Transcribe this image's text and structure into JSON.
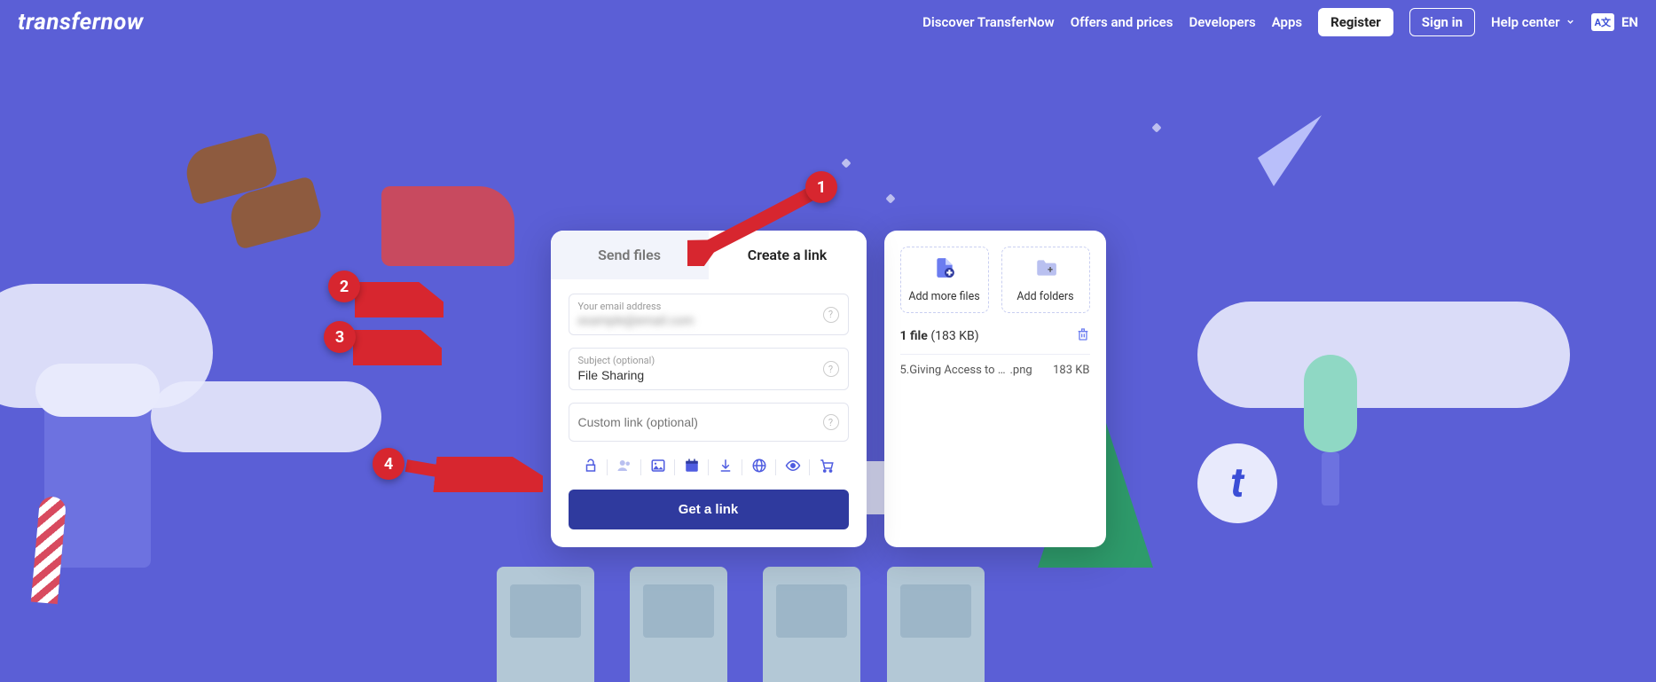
{
  "logo": "transfernow",
  "nav": {
    "discover": "Discover TransferNow",
    "offers": "Offers and prices",
    "developers": "Developers",
    "apps": "Apps",
    "register": "Register",
    "signin": "Sign in",
    "help": "Help center",
    "lang_badge": "A文",
    "lang_code": "EN"
  },
  "tabs": {
    "send": "Send files",
    "link": "Create a link"
  },
  "form": {
    "email_label": "Your email address",
    "email_value": "example@email.com",
    "subject_label": "Subject (optional)",
    "subject_value": "File Sharing",
    "customlink_placeholder": "Custom link (optional)",
    "cta": "Get a link"
  },
  "files": {
    "add_files": "Add more files",
    "add_folders": "Add folders",
    "count_label": "1 file",
    "count_size": "(183 KB)",
    "items": [
      {
        "name": "5.Giving Access to e…",
        "ext": ".png",
        "size": "183 KB"
      }
    ]
  },
  "markers": {
    "m1": "1",
    "m2": "2",
    "m3": "3",
    "m4": "4"
  }
}
